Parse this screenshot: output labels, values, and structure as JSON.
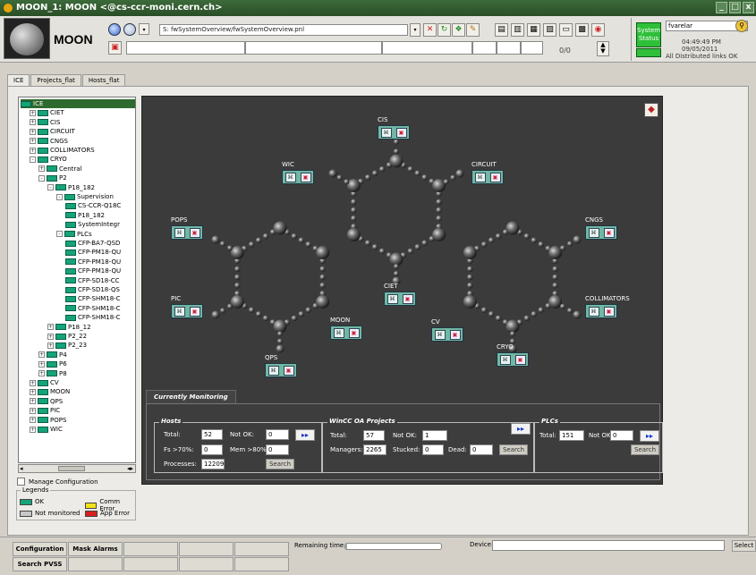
{
  "window": {
    "title": "MOON_1: MOON <@cs-ccr-moni.cern.ch>",
    "controls": [
      "_",
      "□",
      "x"
    ]
  },
  "header": {
    "app_name": "MOON",
    "panel_path": "S: fwSystemOverview/fwSystemOverview.pnl",
    "counter": "0/0",
    "system_status": "System Status",
    "user": "fvarelar",
    "datetime": "04:49:49 PM  09/05/2011",
    "links_status": "All Distributed links OK"
  },
  "tabs": [
    "ICE",
    "Projects_flat",
    "Hosts_flat"
  ],
  "tree": [
    {
      "label": "ICE",
      "depth": 0,
      "selected": true,
      "exp": ""
    },
    {
      "label": "CIET",
      "depth": 1,
      "exp": "+"
    },
    {
      "label": "CIS",
      "depth": 1,
      "exp": "+"
    },
    {
      "label": "CIRCUIT",
      "depth": 1,
      "exp": "+"
    },
    {
      "label": "CNGS",
      "depth": 1,
      "exp": "+"
    },
    {
      "label": "COLLIMATORS",
      "depth": 1,
      "exp": "+"
    },
    {
      "label": "CRYO",
      "depth": 1,
      "exp": "-"
    },
    {
      "label": "Central",
      "depth": 2,
      "exp": "+"
    },
    {
      "label": "P2",
      "depth": 2,
      "exp": "-"
    },
    {
      "label": "P18_182",
      "depth": 3,
      "exp": "-"
    },
    {
      "label": "Supervision",
      "depth": 4,
      "exp": "-"
    },
    {
      "label": "CS-CCR-Q18C",
      "depth": 5,
      "exp": ""
    },
    {
      "label": "P18_182",
      "depth": 5,
      "exp": ""
    },
    {
      "label": "SystemIntegr",
      "depth": 5,
      "exp": ""
    },
    {
      "label": "PLCs",
      "depth": 4,
      "exp": "-"
    },
    {
      "label": "CFP-BA7-QSD",
      "depth": 5,
      "exp": ""
    },
    {
      "label": "CFP-PM18-QU",
      "depth": 5,
      "exp": ""
    },
    {
      "label": "CFP-PM18-QU",
      "depth": 5,
      "exp": ""
    },
    {
      "label": "CFP-PM18-QU",
      "depth": 5,
      "exp": ""
    },
    {
      "label": "CFP-SD18-CC",
      "depth": 5,
      "exp": ""
    },
    {
      "label": "CFP-SD18-QS",
      "depth": 5,
      "exp": ""
    },
    {
      "label": "CFP-SHM18-C",
      "depth": 5,
      "exp": ""
    },
    {
      "label": "CFP-SHM18-C",
      "depth": 5,
      "exp": ""
    },
    {
      "label": "CFP-SHM18-C",
      "depth": 5,
      "exp": ""
    },
    {
      "label": "P18_12",
      "depth": 3,
      "exp": "+"
    },
    {
      "label": "P2_22",
      "depth": 3,
      "exp": "+"
    },
    {
      "label": "P2_23",
      "depth": 3,
      "exp": "+"
    },
    {
      "label": "P4",
      "depth": 2,
      "exp": "+"
    },
    {
      "label": "P6",
      "depth": 2,
      "exp": "+"
    },
    {
      "label": "P8",
      "depth": 2,
      "exp": "+"
    },
    {
      "label": "CV",
      "depth": 1,
      "exp": "+"
    },
    {
      "label": "MOON",
      "depth": 1,
      "exp": "+"
    },
    {
      "label": "QPS",
      "depth": 1,
      "exp": "+"
    },
    {
      "label": "PIC",
      "depth": 1,
      "exp": "+"
    },
    {
      "label": "POPS",
      "depth": 1,
      "exp": "+"
    },
    {
      "label": "WIC",
      "depth": 1,
      "exp": "+"
    }
  ],
  "manage_configuration": "Manage Configuration",
  "legends": {
    "title": "Legends",
    "ok": "OK",
    "comm_error": "Comm Error",
    "not_monitored": "Not monitored",
    "app_error": "App Error",
    "colors": {
      "ok": "#16a37a",
      "comm_error": "#f2e21a",
      "not_monitored": "#c8c8c8",
      "app_error": "#d81e1e"
    }
  },
  "graph_nodes": [
    {
      "label": "CIS"
    },
    {
      "label": "WIC"
    },
    {
      "label": "CIRCUIT"
    },
    {
      "label": "POPS"
    },
    {
      "label": "CNGS"
    },
    {
      "label": "CIET"
    },
    {
      "label": "PIC"
    },
    {
      "label": "COLLIMATORS"
    },
    {
      "label": "MOON"
    },
    {
      "label": "CV"
    },
    {
      "label": "CRYO"
    },
    {
      "label": "QPS"
    }
  ],
  "monitoring": {
    "tab": "Currently Monitoring",
    "hosts": {
      "title": "Hosts",
      "total_label": "Total:",
      "total": "52",
      "notok_label": "Not OK:",
      "notok": "0",
      "fs_label": "Fs >70%:",
      "fs": "0",
      "mem_label": "Mem >80%:",
      "mem": "0",
      "proc_label": "Processes:",
      "proc": "12209",
      "search": "Search"
    },
    "wincc": {
      "title": "WinCC OA Projects",
      "total_label": "Total:",
      "total": "57",
      "notok_label": "Not OK:",
      "notok": "1",
      "managers_label": "Managers:",
      "managers": "2265",
      "stucked_label": "Stucked:",
      "stucked": "0",
      "dead_label": "Dead:",
      "dead": "0",
      "search": "Search"
    },
    "plcs": {
      "title": "PLCs",
      "total_label": "Total:",
      "total": "151",
      "notok_label": "Not OK:",
      "notok": "0",
      "search": "Search"
    }
  },
  "bottom": {
    "configuration": "Configuration",
    "mask_alarms": "Mask Alarms",
    "search_pvss": "Search PVSS",
    "remaining_time": "Remaining time",
    "remaining_progress": 0.02,
    "device_label": "Device:",
    "select": "Select"
  }
}
